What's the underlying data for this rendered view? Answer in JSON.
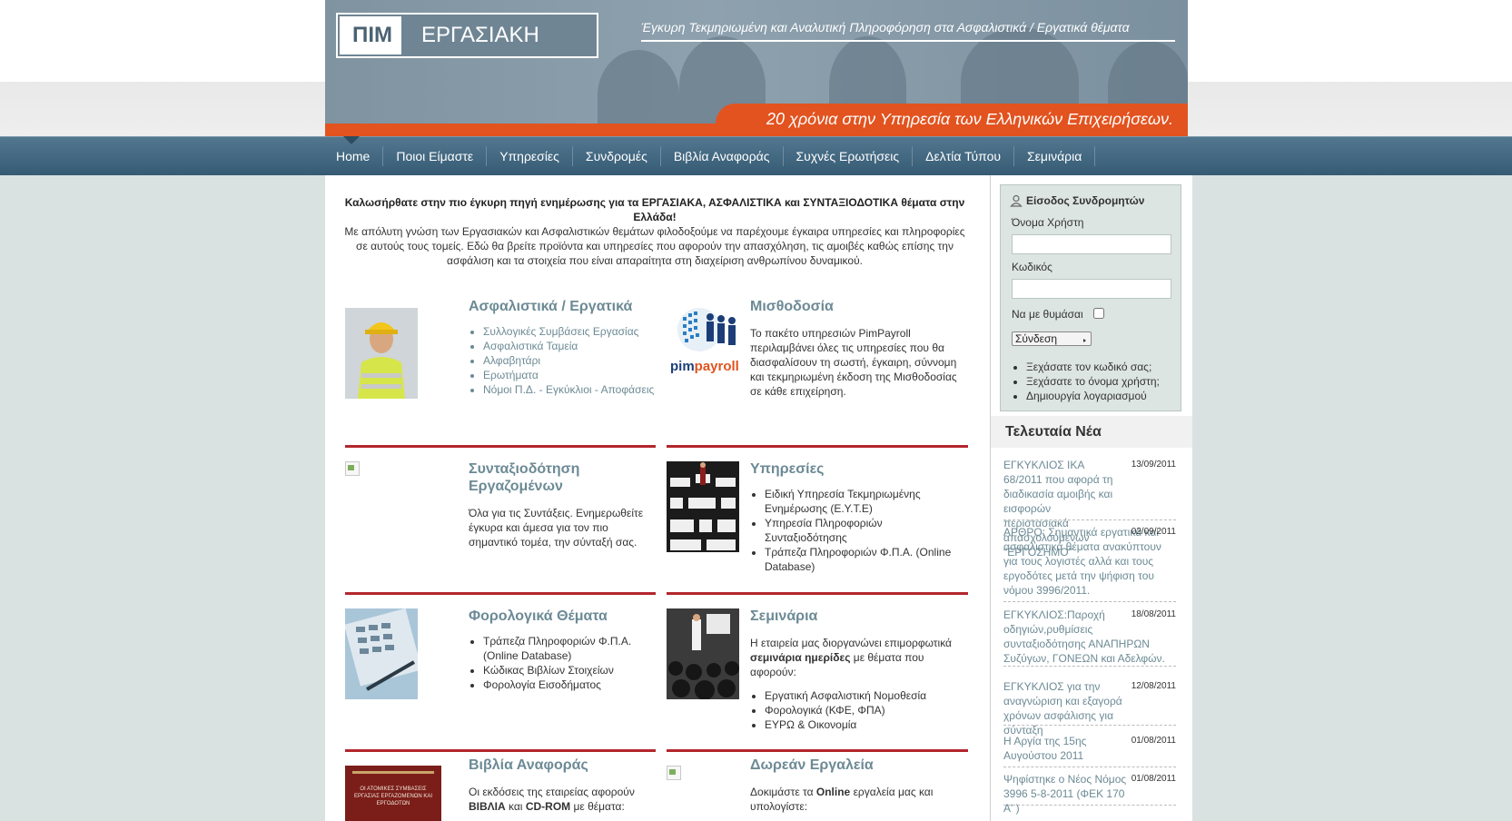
{
  "header": {
    "logo_pim": "ΠΙΜ",
    "logo_ergasiaki": "ΕΡΓΑΣΙΑΚΗ",
    "tagline": "Έγκυρη Τεκμηριωμένη και Αναλυτική Πληροφόρηση στα Ασφαλιστικά / Εργατικά θέματα",
    "anniversary": "20 χρόνια στην Υπηρεσία των Ελληνικών Επιχειρήσεων."
  },
  "nav": {
    "items": [
      "Home",
      "Ποιοι Είμαστε",
      "Υπηρεσίες",
      "Συνδρομές",
      "Βιβλία Αναφοράς",
      "Συχνές Ερωτήσεις",
      "Δελτία Τύπου",
      "Σεμινάρια"
    ]
  },
  "welcome": {
    "headline": "Καλωσήρθατε στην πιο έγκυρη πηγή ενημέρωσης για τα ΕΡΓΑΣΙΑΚΑ, ΑΣΦΑΛΙΣΤΙΚΑ και ΣΥΝΤΑΞΙΟΔΟΤΙΚΑ θέματα στην Ελλάδα!",
    "body": "Με απόλυτη γνώση των Εργασιακών και Ασφαλιστικών θεμάτων φιλοδοξούμε να παρέχουμε έγκαιρα υπηρεσίες και πληροφορίες σε αυτούς τους τομείς. Εδώ θα βρείτε προϊόντα και υπηρεσίες που αφορούν την απασχόληση, τις αμοιβές καθώς επίσης την ασφάλιση και τα στοιχεία που είναι απαραίτητα στη διαχείριση ανθρωπίνου δυναμικού."
  },
  "cards": {
    "insurance": {
      "title": "Ασφαλιστικά / Εργατικά",
      "links": [
        "Συλλογικές Συμβάσεις Εργασίας",
        "Ασφαλιστικά Ταμεία",
        "Αλφαβητάρι",
        "Ερωτήματα"
      ],
      "last_parts": [
        "Νόμοι Π.Δ.",
        "-",
        "Εγκύκλιοι",
        "-",
        "Αποφάσεις"
      ]
    },
    "payroll": {
      "title": "Μισθοδοσία",
      "logo_text_pim": "pim",
      "logo_text_payroll": "payroll",
      "text": "Το πακέτο υπηρεσιών PimPayroll περιλαμβάνει όλες τις υπηρεσίες που θα διασφαλίσουν τη σωστή, έγκαιρη, σύννομη και τεκμηριωμένη έκδοση της Μισθοδοσίας σε κάθε επιχείρηση."
    },
    "pension": {
      "title": "Συνταξιοδότηση Εργαζομένων",
      "text": "Όλα για τις Συντάξεις. Ενημερωθείτε έγκυρα και άμεσα για τον πιο σημαντικό τομέα, την σύνταξή σας."
    },
    "services": {
      "title": "Υπηρεσίες",
      "items": [
        "Ειδική Υπηρεσία Τεκμηριωμένης Ενημέρωσης (Ε.Υ.Τ.Ε)",
        "Υπηρεσία Πληροφοριών Συνταξιοδότησης",
        "Τράπεζα Πληροφοριών Φ.Π.Α. (Online Database)"
      ]
    },
    "tax": {
      "title": "Φορολογικά Θέματα",
      "items": [
        "Τράπεζα Πληροφοριών Φ.Π.Α. (Online Database)",
        "Κώδικας Βιβλίων Στοιχείων",
        "Φορολογία Εισοδήματος"
      ]
    },
    "seminars": {
      "title": "Σεμινάρια",
      "text_before": "Η εταιρεία μας διοργανώνει επιμορφωτικά",
      "text_bold": "σεμινάρια ημερίδες",
      "text_after": "με θέματα που αφορούν:",
      "items": [
        "Εργατική Ασφαλιστική Νομοθεσία",
        "Φορολογικά (ΚΦΕ, ΦΠΑ)",
        "ΕΥΡΩ & Οικονομία"
      ]
    },
    "books": {
      "title": "Βιβλία Αναφοράς",
      "text_before": "Οι εκδόσεις της εταιρείας αφορούν",
      "text_bold": "ΒΙΒΛΙΑ",
      "text_mid": "και",
      "text_bold2": "CD-ROM",
      "text_after": "με θέματα:",
      "cover_text": "ΟΙ ΑΤΟΜΙΚΕΣ ΣΥΜΒΑΣΕΙΣ ΕΡΓΑΣΙΑΣ ΕΡΓΑΖΟΜΕΝΩΝ ΚΑΙ ΕΡΓΟΔΟΤΩΝ"
    },
    "tools": {
      "title": "Δωρεάν Εργαλεία",
      "text_before": "Δοκιμάστε τα",
      "text_bold": "Online",
      "text_after": "εργαλεία μας και υπολογίστε:"
    }
  },
  "login": {
    "title": "Είσοδος Συνδρομητών",
    "username_label": "Όνομα Χρήστη",
    "username_value": "",
    "password_label": "Κωδικός",
    "password_value": "",
    "remember_label": "Να με θυμάσαι",
    "submit_label": "Σύνδεση",
    "links": [
      "Ξεχάσατε τον κωδικό σας;",
      "Ξεχάσατε το όνομα χρήστη;",
      "Δημιουργία λογαριασμού"
    ]
  },
  "news": {
    "title": "Τελευταία Νέα",
    "items": [
      {
        "date": "13/09/2011",
        "text": "ΕΓΚΥΚΛΙΟΣ ΙΚΑ 68/2011 που αφορά τη διαδικασία αμοιβής και εισφορών περιστασιακά απασχολούμενων \"ΕΡΓΟΣΗΜΟ\""
      },
      {
        "date": "02/09/2011",
        "text": "ΑΡΘΡΟ: Σημαντικά εργατικά και ασφαλιστικά θέματα ανακύπτουν για τους λογιστές αλλά και τους εργοδότες μετά την ψήφιση του νόμου 3996/2011."
      },
      {
        "date": "18/08/2011",
        "text": "ΕΓΚΥΚΛΙΟΣ:Παροχή οδηγιών,ρυθμίσεις συνταξιοδότησης ΑΝΑΠΗΡΩΝ Συζύγων, ΓΟΝΕΩΝ και Αδελφών."
      },
      {
        "date": "12/08/2011",
        "text": "ΕΓΚΥΚΛΙΟΣ για την αναγνώριση και εξαγορά χρόνων ασφάλισης για σύνταξη"
      },
      {
        "date": "01/08/2011",
        "text": "Η Αργία της 15ης Αυγούστου 2011"
      },
      {
        "date": "01/08/2011",
        "text": "Ψηφίστηκε ο Νέος Νόμος 3996 5-8-2011 (ΦΕΚ 170 Α' )"
      }
    ]
  },
  "colors": {
    "accent_orange": "#e2531f",
    "nav_blue": "#355a73",
    "link_teal": "#6c8a95",
    "divider_red": "#b3262d"
  }
}
